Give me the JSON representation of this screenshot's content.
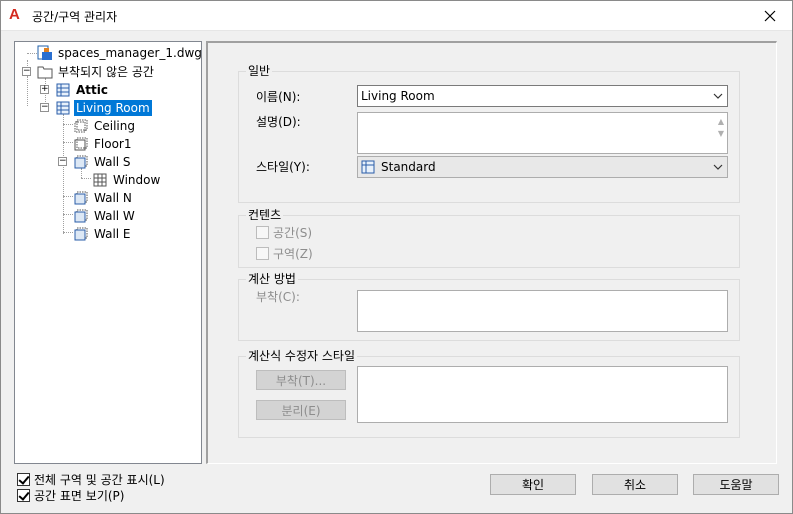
{
  "window": {
    "title": "공간/구역 관리자",
    "app_icon": "autocad-a-icon",
    "close_icon": "close-icon"
  },
  "tree": {
    "root": "spaces_manager_1.dwg",
    "unattached": "부착되지 않은 공간",
    "attic": "Attic",
    "living_room": "Living Room",
    "ceiling": "Ceiling",
    "floor1": "Floor1",
    "wall_s": "Wall S",
    "window": "Window",
    "wall_n": "Wall N",
    "wall_w": "Wall W",
    "wall_e": "Wall E"
  },
  "general": {
    "group_label": "일반",
    "name_label": "이름(N):",
    "name_value": "Living Room",
    "desc_label": "설명(D):",
    "style_label": "스타일(Y):",
    "style_value": "Standard"
  },
  "contents": {
    "group_label": "컨텐츠",
    "spaces_label": "공간(S)",
    "zones_label": "구역(Z)"
  },
  "calc": {
    "group_label": "계산 방법",
    "attach_label": "부착(C):"
  },
  "modifier": {
    "group_label": "계산식 수정자 스타일",
    "attach_btn": "부착(T)...",
    "detach_btn": "분리(E)"
  },
  "footer": {
    "show_all_label": "전체 구역 및 공간 표시(L)",
    "show_all_checked": true,
    "show_surfaces_label": "공간 표면 보기(P)",
    "show_surfaces_checked": true,
    "ok": "확인",
    "cancel": "취소",
    "help": "도움말"
  },
  "colors": {
    "selection": "#0078d7",
    "app_icon": "#d42a1f"
  }
}
